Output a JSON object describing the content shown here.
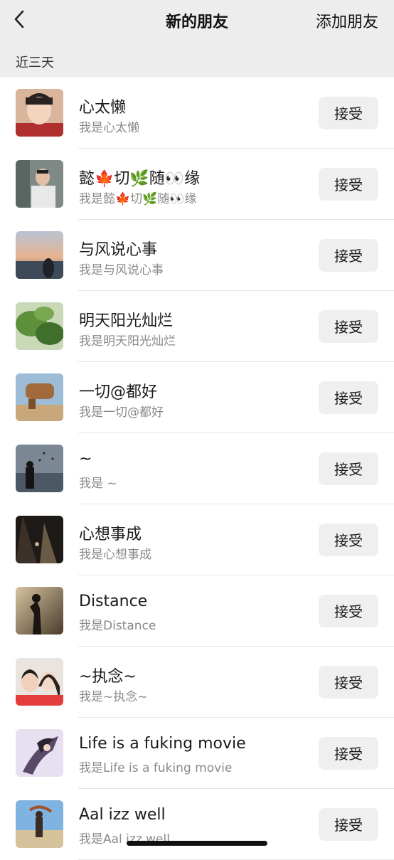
{
  "header": {
    "title": "新的朋友",
    "add_friend": "添加朋友",
    "back_icon": "chevron-left-icon"
  },
  "section": {
    "label": "近三天"
  },
  "accept_label": "接受",
  "friends": [
    {
      "name": "心太懒",
      "intro": "我是心太懒"
    },
    {
      "name": "懿🍁切🌿随👀缘",
      "intro": "我是懿🍁切🌿随👀缘"
    },
    {
      "name": "与风说心事",
      "intro": "我是与风说心事"
    },
    {
      "name": "明天阳光灿烂",
      "intro": "我是明天阳光灿烂"
    },
    {
      "name": "一切@都好",
      "intro": "我是一切@都好"
    },
    {
      "name": "~",
      "intro": "我是 ~"
    },
    {
      "name": "心想事成",
      "intro": "我是心想事成"
    },
    {
      "name": "Distance",
      "intro": "我是Distance"
    },
    {
      "name": "~执念~",
      "intro": "我是~执念~"
    },
    {
      "name": "Life is a fuking movie",
      "intro": "我是Life is a fuking movie"
    },
    {
      "name": "Aal izz well",
      "intro": "我是Aal izz well"
    }
  ]
}
